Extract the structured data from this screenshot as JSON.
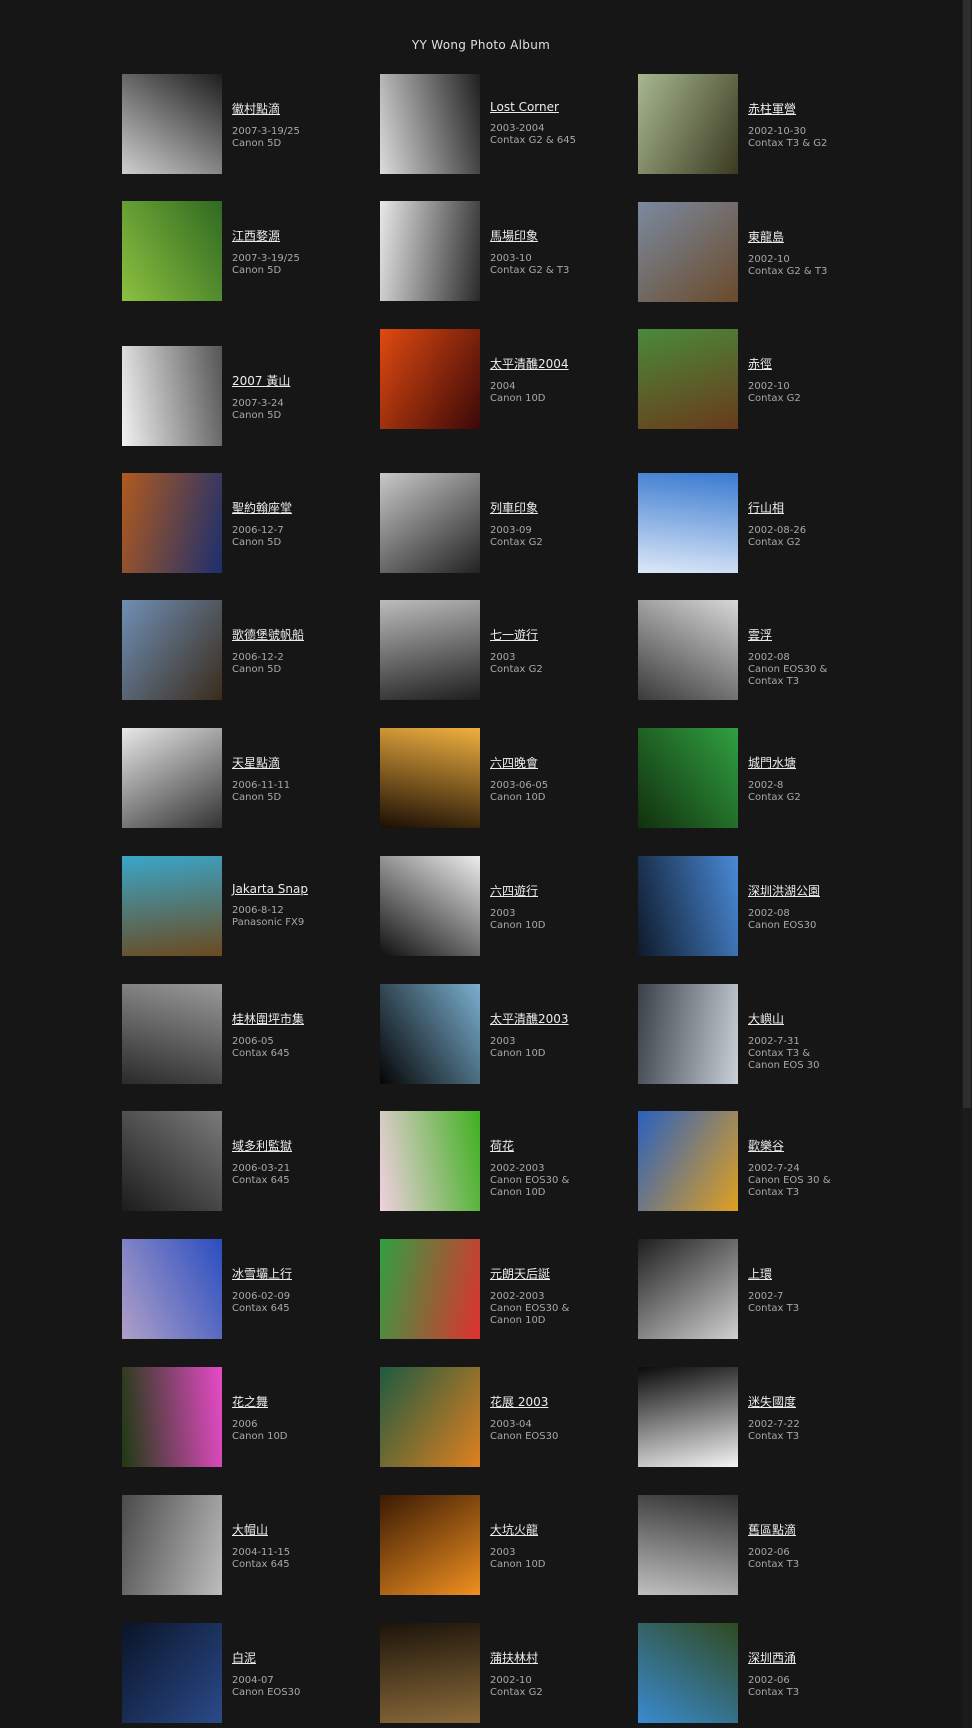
{
  "page_title": "YY Wong Photo Album",
  "columns": [
    [
      {
        "title": "徽村點滴",
        "date": "2007-3-19/25",
        "camera": [
          "Canon 5D"
        ],
        "colors": [
          "#cfcfcf",
          "#1e1e1e"
        ]
      },
      {
        "title": "江西婺源",
        "date": "2007-3-19/25",
        "camera": [
          "Canon 5D"
        ],
        "colors": [
          "#8cc040",
          "#2f6a20"
        ]
      },
      {
        "title": "2007 黃山",
        "date": "2007-3-24",
        "camera": [
          "Canon 5D"
        ],
        "colors": [
          "#f2f2f2",
          "#555555"
        ]
      },
      {
        "title": "聖約翰座堂",
        "date": "2006-12-7",
        "camera": [
          "Canon 5D"
        ],
        "colors": [
          "#b05a1e",
          "#1c2f6e"
        ]
      },
      {
        "title": "歌德堡號帆船",
        "date": "2006-12-2",
        "camera": [
          "Canon 5D"
        ],
        "colors": [
          "#6f8fb5",
          "#3a2c1c"
        ]
      },
      {
        "title": "天星點滴",
        "date": "2006-11-11",
        "camera": [
          "Canon 5D"
        ],
        "colors": [
          "#e8e8e8",
          "#333333"
        ]
      },
      {
        "title": "Jakarta Snap",
        "date": "2006-8-12",
        "camera": [
          "Panasonic FX9"
        ],
        "colors": [
          "#3aa6c8",
          "#6a4a20"
        ]
      },
      {
        "title": "桂林圍坪市集",
        "date": "2006-05",
        "camera": [
          "Contax 645"
        ],
        "colors": [
          "#9a9a9a",
          "#2a2a2a"
        ]
      },
      {
        "title": "域多利監獄",
        "date": "2006-03-21",
        "camera": [
          "Contax 645"
        ],
        "colors": [
          "#7a7a7a",
          "#1c1c1c"
        ]
      },
      {
        "title": "冰雪壩上行",
        "date": "2006-02-09",
        "camera": [
          "Contax 645"
        ],
        "colors": [
          "#2a4ec0",
          "#b0a0c8"
        ]
      },
      {
        "title": "花之舞",
        "date": "2006",
        "camera": [
          "Canon 10D"
        ],
        "colors": [
          "#e84ac8",
          "#1e3a10"
        ]
      },
      {
        "title": "大帽山",
        "date": "2004-11-15",
        "camera": [
          "Contax 645"
        ],
        "colors": [
          "#bdbdbd",
          "#4a4a4a"
        ]
      },
      {
        "title": "白泥",
        "date": "2004-07",
        "camera": [
          "Canon EOS30"
        ],
        "colors": [
          "#2a4a8a",
          "#0a1428"
        ]
      }
    ],
    [
      {
        "title": "Lost Corner",
        "date": "2003-2004",
        "camera": [
          "Contax G2 & 645"
        ],
        "colors": [
          "#dcdcdc",
          "#202020"
        ]
      },
      {
        "title": "馬場印象",
        "date": "2003-10",
        "camera": [
          "Contax G2 & T3"
        ],
        "colors": [
          "#e8e8e8",
          "#2a2a2a"
        ]
      },
      {
        "title": "太平清醮2004",
        "date": "2004",
        "camera": [
          "Canon 10D"
        ],
        "colors": [
          "#e04a10",
          "#3a0808"
        ]
      },
      {
        "title": "列車印象",
        "date": "2003-09",
        "camera": [
          "Contax G2"
        ],
        "colors": [
          "#c8c8c8",
          "#222222"
        ]
      },
      {
        "title": "七一遊行",
        "date": "2003",
        "camera": [
          "Contax G2"
        ],
        "colors": [
          "#bcbcbc",
          "#1e1e1e"
        ]
      },
      {
        "title": "六四晚會",
        "date": "2003-06-05",
        "camera": [
          "Canon 10D"
        ],
        "colors": [
          "#f0b040",
          "#1a0e04"
        ]
      },
      {
        "title": "六四遊行",
        "date": "2003",
        "camera": [
          "Canon 10D"
        ],
        "colors": [
          "#ededed",
          "#101010"
        ]
      },
      {
        "title": "太平清醮2003",
        "date": "2003",
        "camera": [
          "Canon 10D"
        ],
        "colors": [
          "#7ab0d0",
          "#050505"
        ]
      },
      {
        "title": "荷花",
        "date": "2002-2003",
        "camera": [
          "Canon EOS30 &",
          "Canon 10D"
        ],
        "colors": [
          "#40b020",
          "#f0d0e0"
        ]
      },
      {
        "title": "元朗天后誕",
        "date": "2002-2003",
        "camera": [
          "Canon EOS30 &",
          "Canon 10D"
        ],
        "colors": [
          "#e03030",
          "#30a040"
        ]
      },
      {
        "title": "花展 2003",
        "date": "2003-04",
        "camera": [
          "Canon EOS30"
        ],
        "colors": [
          "#e08020",
          "#1e5a40"
        ]
      },
      {
        "title": "大坑火龍",
        "date": "2003",
        "camera": [
          "Canon 10D"
        ],
        "colors": [
          "#f09020",
          "#3a1a04"
        ]
      },
      {
        "title": "蒲扶林村",
        "date": "2002-10",
        "camera": [
          "Contax G2"
        ],
        "colors": [
          "#8a6a3a",
          "#1c140a"
        ]
      }
    ],
    [
      {
        "title": "赤柱軍營",
        "date": "2002-10-30",
        "camera": [
          "Contax T3 & G2"
        ],
        "colors": [
          "#a8b890",
          "#3a3a20"
        ]
      },
      {
        "title": "東龍島",
        "date": "2002-10",
        "camera": [
          "Contax G2 & T3"
        ],
        "colors": [
          "#7a8aa0",
          "#6a4a2a"
        ]
      },
      {
        "title": "赤徑",
        "date": "2002-10",
        "camera": [
          "Contax G2"
        ],
        "colors": [
          "#4a8a3a",
          "#6a3a1a"
        ]
      },
      {
        "title": "行山相",
        "date": "2002-08-26",
        "camera": [
          "Contax G2"
        ],
        "colors": [
          "#3a7ad0",
          "#dce8f8"
        ]
      },
      {
        "title": "雲浮",
        "date": "2002-08",
        "camera": [
          "Canon EOS30 &",
          "Contax T3"
        ],
        "colors": [
          "#d8d8d8",
          "#3a3a3a"
        ]
      },
      {
        "title": "城門水塘",
        "date": "2002-8",
        "camera": [
          "Contax G2"
        ],
        "colors": [
          "#30a040",
          "#12300e"
        ]
      },
      {
        "title": "深圳洪湖公園",
        "date": "2002-08",
        "camera": [
          "Canon EOS30"
        ],
        "colors": [
          "#4a8ad8",
          "#0e1a2a"
        ]
      },
      {
        "title": "大嶼山",
        "date": "2002-7-31",
        "camera": [
          "Contax T3 &",
          "Canon EOS 30"
        ],
        "colors": [
          "#c8d0d8",
          "#3a4048"
        ]
      },
      {
        "title": "歡樂谷",
        "date": "2002-7-24",
        "camera": [
          "Canon EOS 30 &",
          "Contax T3"
        ],
        "colors": [
          "#e0a020",
          "#2a60c0"
        ]
      },
      {
        "title": "上環",
        "date": "2002-7",
        "camera": [
          "Contax T3"
        ],
        "colors": [
          "#d0d0d0",
          "#1e1e1e"
        ]
      },
      {
        "title": "迷失國度",
        "date": "2002-7-22",
        "camera": [
          "Contax T3"
        ],
        "colors": [
          "#f4f4f4",
          "#0a0a0a"
        ]
      },
      {
        "title": "舊區點滴",
        "date": "2002-06",
        "camera": [
          "Contax T3"
        ],
        "colors": [
          "#c0c0c0",
          "#303030"
        ]
      },
      {
        "title": "深圳西涌",
        "date": "2002-06",
        "camera": [
          "Contax T3"
        ],
        "colors": [
          "#3a8ad0",
          "#304a20"
        ]
      }
    ]
  ]
}
